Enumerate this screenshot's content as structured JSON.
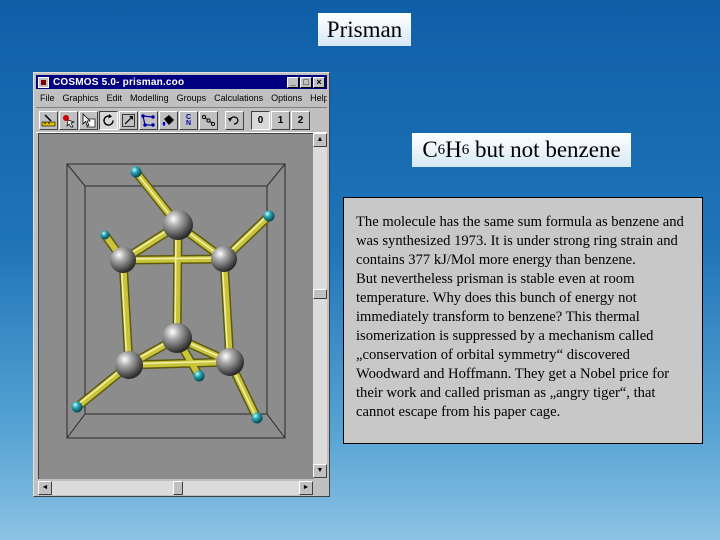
{
  "slide": {
    "title": "Prisman",
    "formula": {
      "c": "C",
      "c_count": "6",
      "h": "H",
      "h_count": "6",
      "suffix": " but not benzene"
    },
    "description": {
      "para1": "The molecule has the same sum formula as benzene and was synthesized 1973. It is under strong ring strain and contains 377 kJ/Mol more energy than benzene.",
      "para2": "But nevertheless prisman is stable even at room temperature. Why does this bunch of energy not immediately transform to benzene? This thermal isomerization is suppressed by a mechanism called „conservation of orbital symmetry“ discovered Woodward and Hoffmann. They get a Nobel price for their work and called prisman as „angry tiger“, that cannot escape from his paper cage."
    }
  },
  "window": {
    "title": "COSMOS 5.0-  prisman.coo",
    "controls": {
      "minimize": "_",
      "maximize": "□",
      "close": "×"
    },
    "menu": [
      "File",
      "Graphics",
      "Edit",
      "Modelling",
      "Groups",
      "Calculations",
      "Options",
      "Help"
    ],
    "toolbar": {
      "icons": [
        "measure-icon",
        "select-atom-icon",
        "pointer-icon",
        "zoom-box-icon",
        "rotate-icon",
        "resize-icon",
        "bond-network-icon",
        "bucket-icon",
        "cn-label-icon",
        "chain-icon",
        "undo-icon"
      ],
      "cn_label": "CN",
      "pages": [
        "0",
        "1",
        "2"
      ]
    },
    "scroll": {
      "up": "▲",
      "down": "▼",
      "left": "◄",
      "right": "►"
    }
  },
  "colors": {
    "canvas": "#8c8c8c",
    "bond": "#c9c43a",
    "carbon": "#6b6b6b",
    "hydrogen": "#1f9aa6",
    "titlebar": "#000080"
  }
}
